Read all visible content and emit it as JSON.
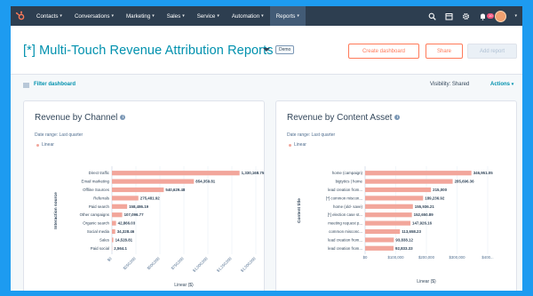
{
  "nav": {
    "items": [
      "Contacts",
      "Conversations",
      "Marketing",
      "Sales",
      "Service",
      "Automation",
      "Reports"
    ],
    "active": "Reports",
    "notification_count": "10"
  },
  "header": {
    "title": "[*] Multi-Touch Revenue Attribution Reports",
    "demo_badge": "Demo",
    "create_dashboard": "Create dashboard",
    "share": "Share",
    "add_report": "Add report"
  },
  "filters": {
    "filter_label": "Filter dashboard",
    "visibility": "Visibility: Shared",
    "actions": "Actions"
  },
  "colors": {
    "bar": "#f2a69b",
    "link": "#0091ae",
    "accent": "#ff7a59",
    "nav": "#2d3e50"
  },
  "chart_data": [
    {
      "type": "bar",
      "orientation": "horizontal",
      "title": "Revenue by Channel",
      "date_range": "Date range: Last quarter",
      "legend": [
        "Linear"
      ],
      "ylabel": "Interaction source",
      "xlabel": "Linear ($)",
      "xlim": [
        0,
        1500000
      ],
      "xticks": [
        "$0",
        "$250,000",
        "$500,000",
        "$750,000",
        "$1,000,000",
        "$1,250,000",
        "$1,500,000"
      ],
      "tick_values": [
        0,
        250000,
        500000,
        750000,
        1000000,
        1250000,
        1500000
      ],
      "categories": [
        "Direct traffic",
        "Email marketing",
        "Offline Sources",
        "Referrals",
        "Paid search",
        "Other campaigns",
        "Organic search",
        "Social media",
        "Sales",
        "Paid social"
      ],
      "values": [
        1330168.75,
        854359.81,
        540629.48,
        275481.92,
        158486.19,
        107096.77,
        42866.03,
        34328.46,
        14528.81,
        2564.1
      ],
      "labels": [
        "1,330,168.75",
        "854,359.81",
        "540,629.48",
        "275,481.92",
        "158,486.19",
        "107,096.77",
        "42,866.03",
        "34,328.46",
        "14,528.81",
        "2,564.1"
      ]
    },
    {
      "type": "bar",
      "orientation": "horizontal",
      "title": "Revenue by Content Asset",
      "date_range": "Date range: Last quarter",
      "legend": [
        "Linear"
      ],
      "ylabel": "Content title",
      "xlabel": "Linear ($)",
      "xlim": [
        0,
        400000
      ],
      "xticks": [
        "$0",
        "$100,000",
        "$200,000",
        "$300,000",
        "$400..."
      ],
      "tick_values": [
        0,
        100000,
        200000,
        300000,
        400000
      ],
      "categories": [
        "home (campaign)",
        "bigtytics | home",
        "lead creation from...",
        "[*] common miscon...",
        "home (old- save)",
        "[*] election case st...",
        "meeting request p...",
        "common misconc...",
        "lead creation from...",
        "lead creation from..."
      ],
      "values": [
        346951.05,
        285696.36,
        215000,
        189236.92,
        155936.21,
        152650.89,
        147926.16,
        113658.23,
        93838.12,
        92833.33
      ],
      "labels": [
        "346,951.05",
        "285,696.36",
        "215,000",
        "189,236.92",
        "155,936.21",
        "152,650.89",
        "147,926.16",
        "113,658.23",
        "93,838.12",
        "92,833.33"
      ]
    }
  ]
}
